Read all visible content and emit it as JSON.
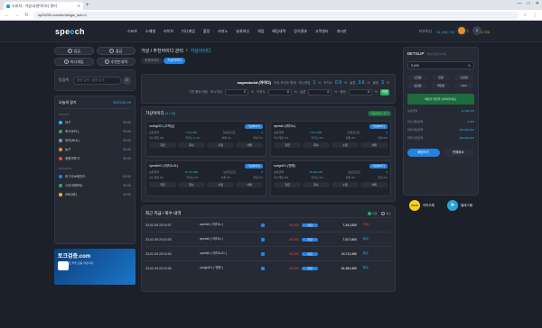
{
  "browser": {
    "tab_title": "스피치 - 가상/추천아이디 관리",
    "url": "sp20200.com/kr/ulingw_sub=1",
    "new_tab": "+",
    "win_buttons": [
      "—",
      "□",
      "✕"
    ]
  },
  "header": {
    "logo_a": "spe",
    "logo_b": "e",
    "logo_c": "ch",
    "nav": [
      "스포츠",
      "스페셜",
      "라이브",
      "미니게임",
      "볼링",
      "카지노",
      "슬롯머신",
      "게임",
      "배팅내역",
      "경기결과",
      "고객센터",
      "게시판"
    ],
    "money_label": "보유머니",
    "money": "11,190,723",
    "point_label": "포인트",
    "point": "2,420,720"
  },
  "sidebar": {
    "btn_login": "입금",
    "btn_withdraw": "출금",
    "btn_mini": "미니게임",
    "btn_rec": "추천인내역",
    "search_label": "팀검색",
    "search_placeholder": "팀명 입력 / 팀명 검색",
    "today_title": "오늘의 경기",
    "today_date": "2023.02.09",
    "section1": "SPORTS",
    "sports": [
      {
        "name": "야구",
        "time": "00:00",
        "color": "#2db7f5"
      },
      {
        "name": "축구(EPL)",
        "time": "00:00",
        "color": "#27ae60"
      },
      {
        "name": "하키(NHL)",
        "time": "00:00",
        "color": "#8b93a3"
      },
      {
        "name": "농구",
        "time": "00:00",
        "color": "#e8912a"
      },
      {
        "name": "종합격투기",
        "time": "00:00",
        "color": "#e74c3c"
      }
    ],
    "section2": "ESPORTS",
    "esports": [
      {
        "name": "리그오브레전드",
        "time": "00:00",
        "color": "#2383e2"
      },
      {
        "name": "스타크래프트",
        "time": "00:00",
        "color": "#27ae60"
      },
      {
        "name": "오버워치",
        "time": "00:00",
        "color": "#e8b13a"
      }
    ],
    "ad_title": "토크검증.com",
    "ad_sub": "스포츠 토토 먹튀 검증 커뮤니티"
  },
  "main": {
    "breadcrumb_main": "가상 / 추천아이디 관리",
    "breadcrumb_sub": "가상아이디",
    "tabs": [
      "추천아이디",
      "가상아이디"
    ],
    "summary_line1": {
      "user": "sograsbokd (아이디)",
      "desc": "보유 포인트 합계",
      "l1": "미니게임",
      "v1": "1",
      "u": "%",
      "l2": "카지노",
      "v2": "0.9",
      "l3": "슬롯",
      "v3": "3.6",
      "l4": "볼링",
      "v4": "3"
    },
    "summary_line2": {
      "label": "기준 롤링 세팅",
      "l1": "미니게임",
      "v1": "0",
      "l2": "카지노",
      "v2": "0",
      "l3": "슬롯",
      "v3": "0",
      "l4": "볼링",
      "v4": "0",
      "u": "%",
      "btn": "적용"
    },
    "virtual_title": "가상아이디",
    "virtual_count": "(4 / 10)",
    "virtual_badge": "가상아이디 추가",
    "cards": [
      {
        "name": "xcdhg001 (고객님)",
        "tag": "가상아이디",
        "bal_label": "보유금액",
        "bal": "7,441,800",
        "pt_label": "보유포인트",
        "pt": "0",
        "p": [
          "미니게임 0%",
          "카지노 0.4%",
          "슬롯 0%",
          "볼링 0%"
        ]
      },
      {
        "name": "apeskh (매치노)",
        "tag": "가상아이디",
        "bal_label": "보유금액",
        "bal": "7,617,800",
        "pt_label": "보유포인트",
        "pt": "0",
        "p": [
          "미니게임 1%",
          "카지노 0%",
          "슬롯 0%",
          "볼링 0%"
        ]
      },
      {
        "name": "opeskh01 (매치노01)",
        "tag": "가상아이디",
        "bal_label": "보유금액",
        "bal": "15,711,980",
        "pt_label": "보유포인트",
        "pt": "0",
        "p": [
          "미니게임 0%",
          "카지노 0%",
          "슬롯 0%",
          "볼링 0%"
        ]
      },
      {
        "name": "scdgnt01 (맹맹)",
        "tag": "가상아이디",
        "bal_label": "보유금액",
        "bal": "15,484,360",
        "pt_label": "보유포인트",
        "pt": "0",
        "p": [
          "미니게임 0%",
          "카지노 0%",
          "슬롯 0%",
          "볼링 0%"
        ]
      }
    ],
    "card_actions": [
      "지급",
      "회수",
      "수정",
      "삭제"
    ],
    "history_title": "최근 지급 / 회수 내역",
    "history_radio": [
      "지급",
      "회수"
    ],
    "history": [
      {
        "date": "23-02-09 23:10:07",
        "user": "apeskh ( 매치노 )",
        "amount": "50,000",
        "status": "지급",
        "total": "7,441,800",
        "result": "지급",
        "rcls": "red"
      },
      {
        "date": "23-02-09 23:10:03",
        "user": "apeskh ( 매치노 )",
        "amount": "50,000",
        "status": "지급",
        "total": "7,617,800",
        "result": "회수",
        "rcls": "blue"
      },
      {
        "date": "23-02-09 23:10:00",
        "user": "opeskh ( 매치노01 )",
        "amount": "50,000",
        "status": "지급",
        "total": "15,711,980",
        "result": "회수",
        "rcls": "blue"
      },
      {
        "date": "23-02-09 23:10:04",
        "user": "scdgnt01 ( 맹맹 )",
        "amount": "50,000",
        "status": "지급",
        "total": "15,484,360",
        "result": "회수",
        "rcls": "blue"
      }
    ]
  },
  "betslip": {
    "title": "BETSLIP",
    "subtitle": "배팅카트(0/10개)",
    "input": "5,000",
    "chips": [
      "오천원",
      "만원",
      "오만원",
      "십만원",
      "백만원",
      "MAX"
    ],
    "notice": "배팅할 게임을 선택해주세요.",
    "held_label": "보유금액",
    "held": "11,190,723",
    "odds_label": "최소 배팅금액",
    "odds": "5,000",
    "max_label": "최대 배팅금액",
    "max": "300,000,000",
    "hit_label": "최대 당첨금액",
    "hit": "300,000,000",
    "btn_bet": "배팅하기",
    "btn_clear": "전체취소"
  },
  "social": {
    "kakao_icon": "TALK",
    "kakao": "카카오톡",
    "telegram": "텔레그램"
  }
}
